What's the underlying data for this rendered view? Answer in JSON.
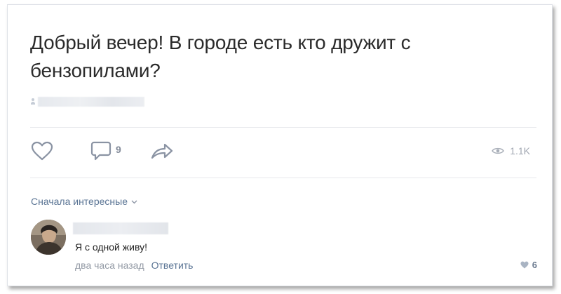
{
  "post": {
    "text": "Добрый вечер! В городе есть кто дружит с бензопилами?"
  },
  "actions": {
    "like_icon": "heart-outline-icon",
    "comment_icon": "comment-bubble-icon",
    "comment_count": "9",
    "share_icon": "share-arrow-icon",
    "views_icon": "eye-icon",
    "views_count": "1.1K"
  },
  "comments_sort": {
    "label": "Сначала интересные",
    "icon": "chevron-down-icon"
  },
  "comment": {
    "text": "Я с одной живу!",
    "time": "два часа назад",
    "reply_label": "Ответить",
    "likes": "6",
    "likes_icon": "heart-filled-icon"
  },
  "colors": {
    "link": "#5a7494",
    "muted": "#828a99",
    "text": "#2b2b2b"
  }
}
